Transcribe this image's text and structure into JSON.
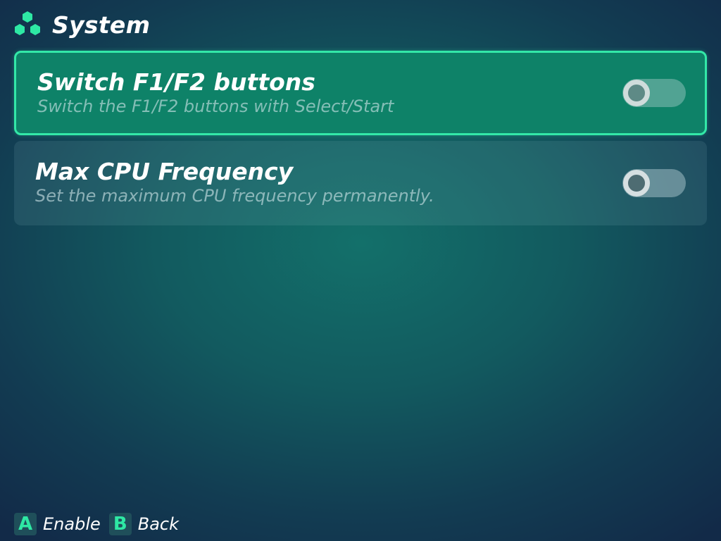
{
  "header": {
    "icon": "hexagon-cluster-icon",
    "title": "System",
    "accent_color": "#2EE8A4"
  },
  "settings": [
    {
      "label": "Switch F1/F2 buttons",
      "description": "Switch the F1/F2 buttons with Select/Start",
      "enabled": false,
      "selected": true
    },
    {
      "label": "Max CPU Frequency",
      "description": "Set the maximum CPU frequency permanently.",
      "enabled": false,
      "selected": false
    }
  ],
  "footer": {
    "hints": [
      {
        "key": "A",
        "label": "Enable"
      },
      {
        "key": "B",
        "label": "Back"
      }
    ]
  }
}
